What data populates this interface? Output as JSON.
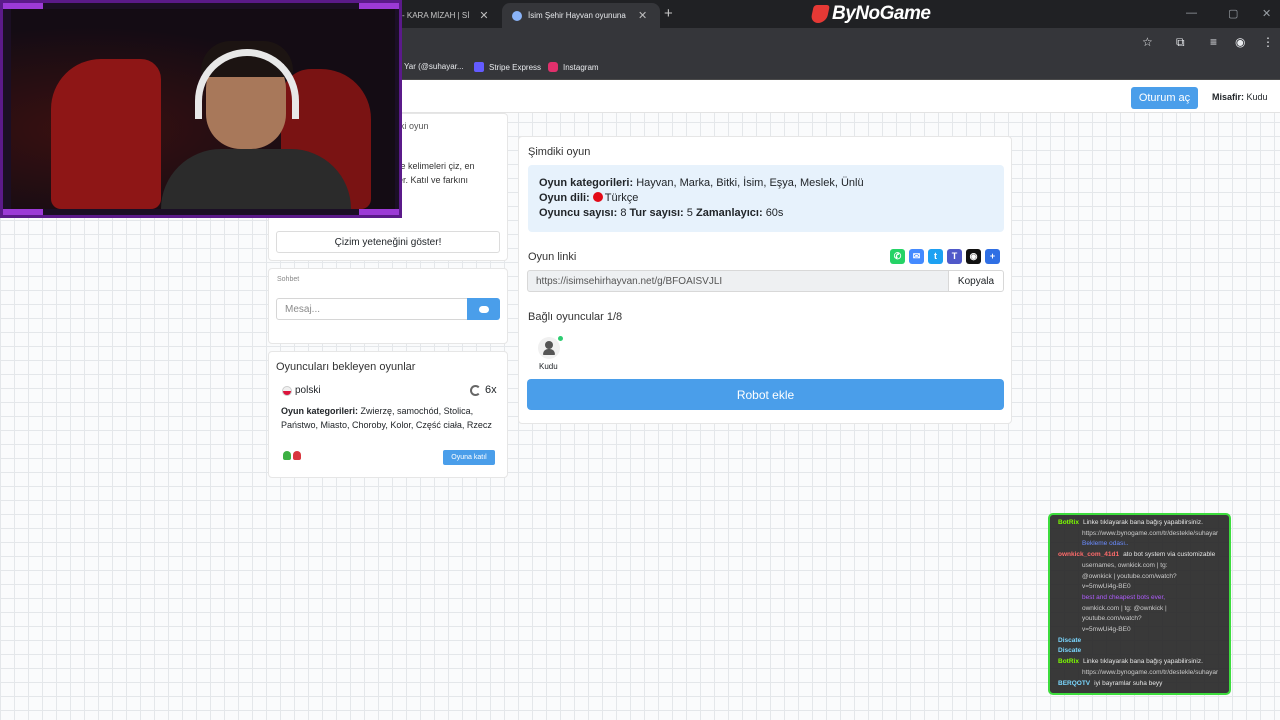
{
  "browser": {
    "tabs": [
      {
        "label": "- KARA MİZAH | Sİ"
      },
      {
        "label": "İsim Şehir Hayvan oyununa katıl"
      }
    ],
    "brand": "ByNoGame",
    "bookmarks": [
      {
        "label": "Yar (@suhayar...",
        "color": "#777777"
      },
      {
        "label": "Stripe Express",
        "color": "#635bff"
      },
      {
        "label": "Instagram",
        "color": "#e1306c"
      }
    ]
  },
  "header": {
    "login_label": "Oturum aç",
    "guest_label": "Misafir:",
    "guest_name": "Kudu"
  },
  "left": {
    "top_label": "ki oyun",
    "rules_line1": "te kelimeleri çiz, en",
    "rules_line2": "er. Katıl ve farkını",
    "draw_button": "Çizim yeteneğini göster!",
    "chat": {
      "title": "Sohbet",
      "placeholder": "Mesaj..."
    },
    "waiting": {
      "title": "Oyuncuları bekleyen oyunlar",
      "game": {
        "language": "polski",
        "rounds": "6x",
        "categories_label": "Oyun kategorileri:",
        "categories": "Zwierzę, samochód, Stolica, Państwo, Miasto, Choroby, Kolor, Część ciała, Rzecz",
        "join_label": "Oyuna katıl"
      }
    }
  },
  "current_game": {
    "title": "Şimdiki oyun",
    "categories_label": "Oyun kategorileri:",
    "categories": "Hayvan, Marka, Bitki, İsim, Eşya, Meslek, Ünlü",
    "language_label": "Oyun dili:",
    "language": "Türkçe",
    "players_label": "Oyuncu sayısı:",
    "players_value": "8",
    "rounds_label": "Tur sayısı:",
    "rounds_value": "5",
    "timer_label": "Zamanlayıcı:",
    "timer_value": "60s",
    "link_title": "Oyun linki",
    "link_value": "https://isimsehirhayvan.net/g/BFOAISVJLI",
    "copy_label": "Kopyala",
    "connected_title": "Bağlı oyuncular 1/8",
    "player_name": "Kudu",
    "robot_label": "Robot ekle",
    "share_icons": [
      {
        "name": "whatsapp-icon",
        "color": "#25d366"
      },
      {
        "name": "messenger-icon",
        "color": "#448aff"
      },
      {
        "name": "twitter-icon",
        "color": "#1da1f2"
      },
      {
        "name": "teams-icon",
        "color": "#5059c9"
      },
      {
        "name": "snapchat-icon",
        "color": "#111111"
      },
      {
        "name": "plus-icon",
        "color": "#2f6fe4"
      }
    ]
  },
  "stream_chat": [
    {
      "user": "BotRix",
      "color": "#7cfc00",
      "text": "Linke tıklayarak bana bağış yapabilirsiniz."
    },
    {
      "user": "",
      "color": "#cccccc",
      "text": "https://www.bynogame.com/tr/destekle/suhayar"
    },
    {
      "user": "",
      "color": "#6a8cff",
      "text": "Bekleme odası.."
    },
    {
      "user": "ownkick_com_41d1",
      "color": "#ff6b6b",
      "text": "ato bot system via customizable"
    },
    {
      "user": "",
      "color": "#cccccc",
      "text": "usernames, ownkick.com | tg:"
    },
    {
      "user": "",
      "color": "#cccccc",
      "text": "@ownkick | youtube.com/watch?"
    },
    {
      "user": "",
      "color": "#cccccc",
      "text": "v=5mwUi4g-BE0"
    },
    {
      "user": "",
      "color": "#b05cff",
      "text": "best and cheapest bots ever,"
    },
    {
      "user": "",
      "color": "#cccccc",
      "text": "ownkick.com | tg: @ownkick |"
    },
    {
      "user": "",
      "color": "#cccccc",
      "text": "youtube.com/watch?"
    },
    {
      "user": "",
      "color": "#cccccc",
      "text": "v=5mwUi4g-BE0"
    },
    {
      "user": "Discate",
      "color": "#7ad7ff",
      "text": ""
    },
    {
      "user": "Discate",
      "color": "#7ad7ff",
      "text": ""
    },
    {
      "user": "BotRix",
      "color": "#7cfc00",
      "text": "Linke tıklayarak bana bağış yapabilirsiniz."
    },
    {
      "user": "",
      "color": "#cccccc",
      "text": "https://www.bynogame.com/tr/destekle/suhayar"
    },
    {
      "user": "BERQOTV",
      "color": "#7ad7ff",
      "text": "iyi bayramlar suha beyy"
    }
  ],
  "colors": {
    "accent": "#4a9eea",
    "info_bg": "#e7f2fc",
    "chat_border": "#3ddc3d",
    "webcam_frame": "#5b1a8a"
  }
}
